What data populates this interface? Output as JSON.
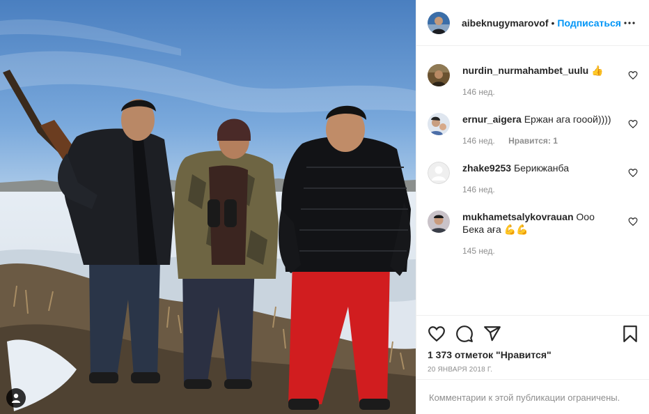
{
  "post": {
    "photo_alt": "Three men standing on a snowy hill under a blue sky",
    "user_tag_icon": "person-icon"
  },
  "header": {
    "username": "aibeknugymarovof",
    "separator": "•",
    "follow_label": "Подписаться",
    "more_icon": "more-horizontal-icon"
  },
  "comments": [
    {
      "user": "nurdin_nurmahambet_uulu",
      "text": "👍",
      "age": "146 нед.",
      "likes": ""
    },
    {
      "user": "ernur_aigera",
      "text": "Ержан ага гооой))))",
      "age": "146 нед.",
      "likes": "Нравится: 1"
    },
    {
      "user": "zhake9253",
      "text": "Берикжанба",
      "age": "146 нед.",
      "likes": ""
    },
    {
      "user": "mukhametsalykovrauan",
      "text": "Ооо Бека аға 💪💪",
      "age": "145 нед.",
      "likes": ""
    }
  ],
  "actions": {
    "like_icon": "heart-icon",
    "comment_icon": "comment-icon",
    "share_icon": "share-icon",
    "save_icon": "bookmark-icon",
    "likes_text": "1 373 отметок \"Нравится\"",
    "date_text": "20 января 2018 г.",
    "restricted_text": "Комментарии к этой публикации ограничены."
  },
  "colors": {
    "accent": "#0095f6",
    "text_primary": "#262626",
    "text_secondary": "#8e8e8e",
    "divider": "#efefef"
  }
}
